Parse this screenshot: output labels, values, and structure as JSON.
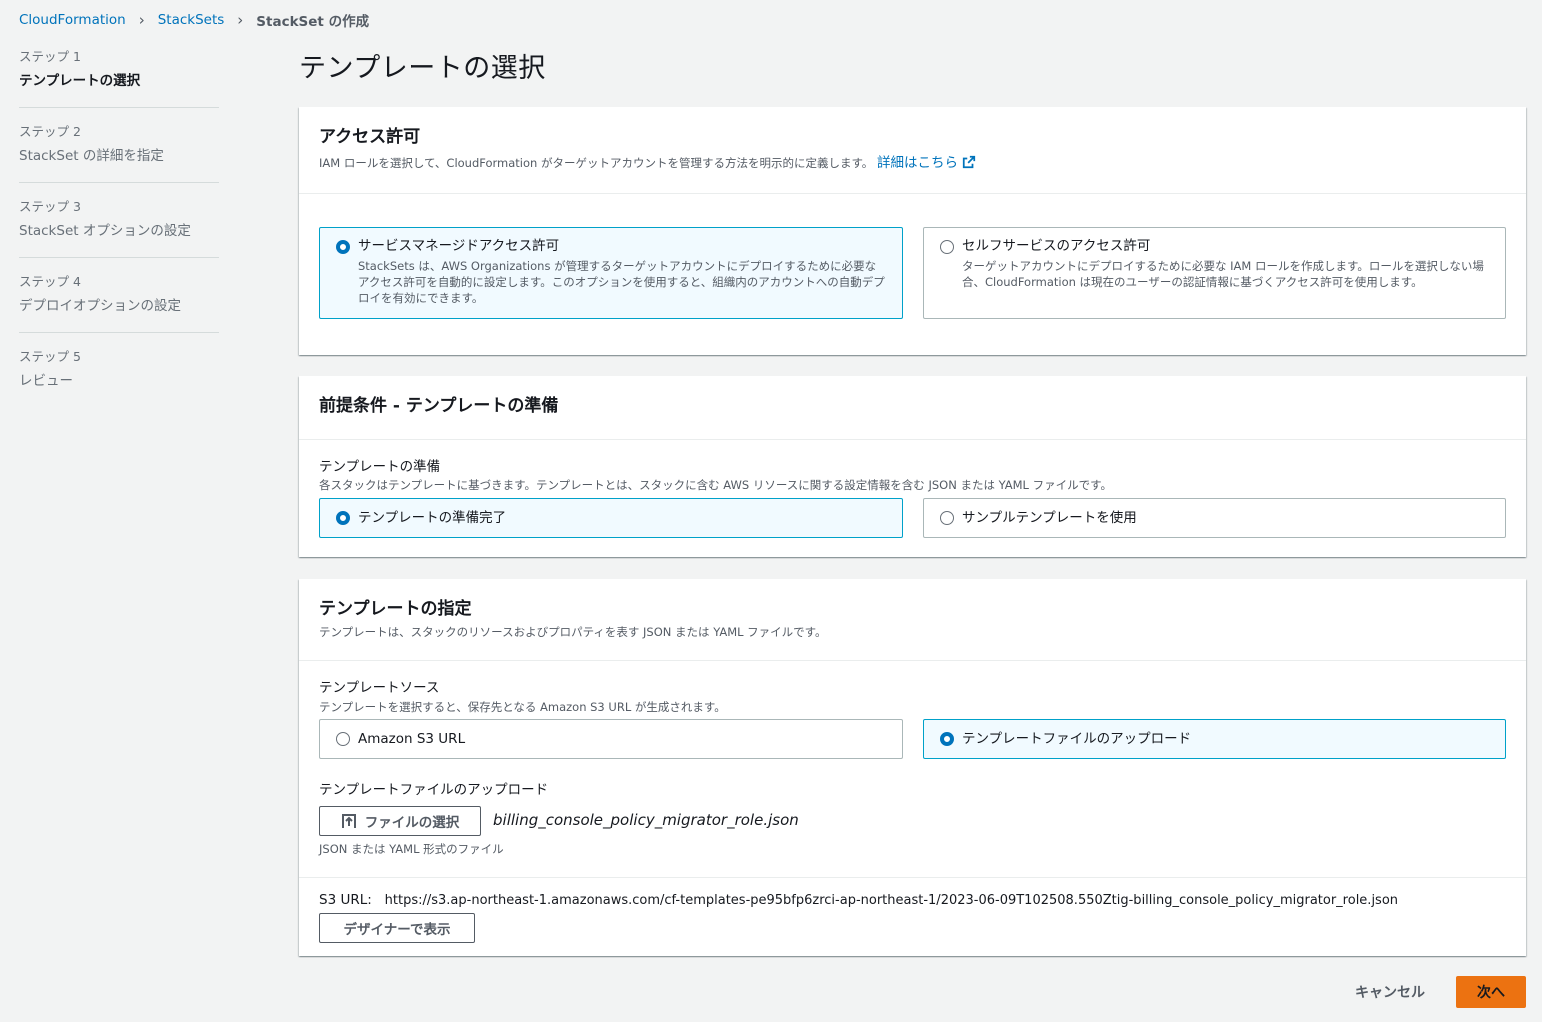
{
  "breadcrumb": [
    {
      "label": "CloudFormation"
    },
    {
      "label": "StackSets"
    },
    {
      "label": "StackSet の作成"
    }
  ],
  "steps": [
    {
      "num": "ステップ 1",
      "name": "テンプレートの選択",
      "active": true
    },
    {
      "num": "ステップ 2",
      "name": "StackSet の詳細を指定",
      "active": false
    },
    {
      "num": "ステップ 3",
      "name": "StackSet オプションの設定",
      "active": false
    },
    {
      "num": "ステップ 4",
      "name": "デプロイオプションの設定",
      "active": false
    },
    {
      "num": "ステップ 5",
      "name": "レビュー",
      "active": false
    }
  ],
  "page_title": "テンプレートの選択",
  "access": {
    "title": "アクセス許可",
    "desc": "IAM ロールを選択して、CloudFormation がターゲットアカウントを管理する方法を明示的に定義します。",
    "learn_more": "詳細はこちら",
    "options": [
      {
        "label": "サービスマネージドアクセス許可",
        "desc": "StackSets は、AWS Organizations が管理するターゲットアカウントにデプロイするために必要なアクセス許可を自動的に設定します。このオプションを使用すると、組織内のアカウントへの自動デプロイを有効にできます。",
        "selected": true
      },
      {
        "label": "セルフサービスのアクセス許可",
        "desc": "ターゲットアカウントにデプロイするために必要な IAM ロールを作成します。ロールを選択しない場合、CloudFormation は現在のユーザーの認証情報に基づくアクセス許可を使用します。",
        "selected": false
      }
    ]
  },
  "prereq": {
    "title": "前提条件 - テンプレートの準備",
    "field_label": "テンプレートの準備",
    "field_desc": "各スタックはテンプレートに基づきます。テンプレートとは、スタックに含む AWS リソースに関する設定情報を含む JSON または YAML ファイルです。",
    "options": [
      {
        "label": "テンプレートの準備完了",
        "selected": true
      },
      {
        "label": "サンプルテンプレートを使用",
        "selected": false
      }
    ]
  },
  "specify": {
    "title": "テンプレートの指定",
    "desc": "テンプレートは、スタックのリソースおよびプロパティを表す JSON または YAML ファイルです。",
    "source_label": "テンプレートソース",
    "source_desc": "テンプレートを選択すると、保存先となる Amazon S3 URL が生成されます。",
    "options": [
      {
        "label": "Amazon S3 URL",
        "selected": false
      },
      {
        "label": "テンプレートファイルのアップロード",
        "selected": true
      }
    ],
    "upload_label": "テンプレートファイルのアップロード",
    "choose_file": "ファイルの選択",
    "file_name": "billing_console_policy_migrator_role.json",
    "file_hint": "JSON または YAML 形式のファイル",
    "s3_url_label": "S3 URL:",
    "s3_url": "https://s3.ap-northeast-1.amazonaws.com/cf-templates-pe95bfp6zrci-ap-northeast-1/2023-06-09T102508.550Ztig-billing_console_policy_migrator_role.json",
    "designer_button": "デザイナーで表示"
  },
  "footer": {
    "cancel": "キャンセル",
    "next": "次へ"
  },
  "colors": {
    "link": "#0073bb",
    "selected_border": "#00a1c9",
    "selected_bg": "#f1faff",
    "primary": "#ec7211"
  }
}
